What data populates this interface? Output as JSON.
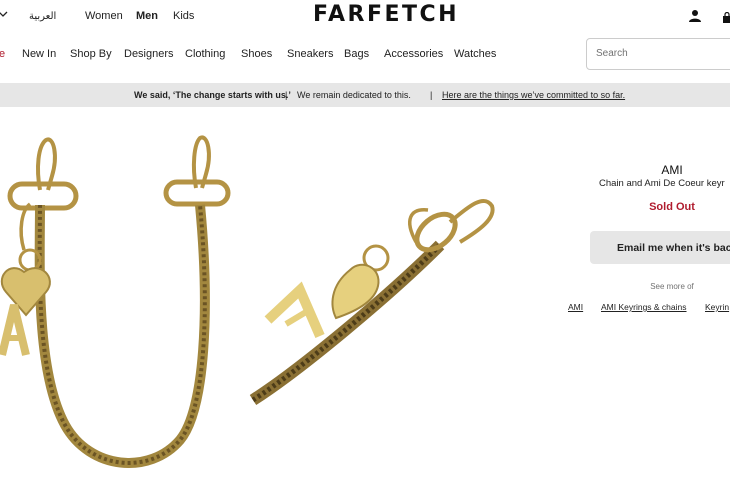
{
  "header": {
    "language_label": "العربية",
    "gender_tabs": [
      {
        "label": "Women",
        "active": false
      },
      {
        "label": "Men",
        "active": true
      },
      {
        "label": "Kids",
        "active": false
      }
    ],
    "logo": "FARFETCH",
    "icons": [
      "chevron-down-icon",
      "account-icon",
      "bag-icon"
    ]
  },
  "nav": {
    "items": [
      "e",
      "New In",
      "Shop By",
      "Designers",
      "Clothing",
      "Shoes",
      "Sneakers",
      "Bags",
      "Accessories",
      "Watches"
    ],
    "search_placeholder": "Search"
  },
  "banner": {
    "statement": "We said, ‘The change starts with us.’",
    "sep1": "|",
    "middle": "We remain dedicated to this.",
    "sep2": "|",
    "link": "Here are the things we’ve committed to so far."
  },
  "product": {
    "brand": "AMI",
    "name": "Chain and Ami De Coeur keyr",
    "status": "Sold Out",
    "status_color": "#b01c2e",
    "email_button": "Email me when it's back",
    "see_more": "See more of",
    "related": [
      "AMI",
      "AMI Keyrings & chains",
      "Keyrin"
    ]
  }
}
